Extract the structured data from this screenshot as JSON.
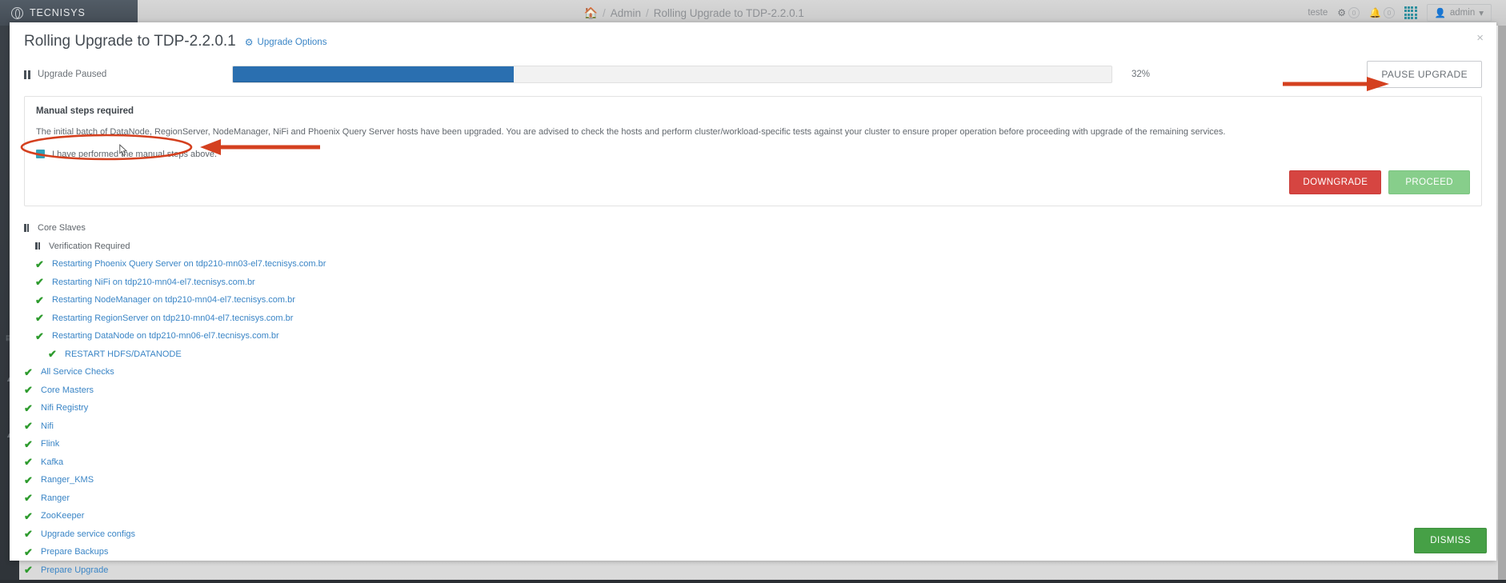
{
  "brand": {
    "name": "TECNISYS",
    "logo_icon": "circle-logo-icon"
  },
  "breadcrumb": {
    "home_icon": "home-icon",
    "sep": "/",
    "items": [
      "Admin",
      "Rolling Upgrade to TDP-2.2.0.1"
    ]
  },
  "topbar_right": {
    "cluster_name": "teste",
    "gear_icon": "gear-icon",
    "gear_badge": "0",
    "bell_icon": "bell-icon",
    "bell_badge": "0",
    "grid_icon": "grid-icon",
    "user_icon": "user-icon",
    "user_label": "admin",
    "caret_icon": "caret-down-icon"
  },
  "modal": {
    "title": "Rolling Upgrade to TDP-2.2.0.1",
    "upgrade_options_label": "Upgrade Options",
    "upgrade_options_icon": "cogs-icon",
    "close_icon": "close-icon",
    "close_glyph": "×"
  },
  "progress": {
    "status_icon": "pause-icon",
    "status_label": "Upgrade Paused",
    "percent_label": "32%",
    "percent_value": 32,
    "bar_color": "#2a6fb0",
    "pause_button_label": "PAUSE UPGRADE"
  },
  "manual_panel": {
    "title": "Manual steps required",
    "description": "The initial batch of DataNode, RegionServer, NodeManager, NiFi and Phoenix Query Server hosts have been upgraded. You are advised to check the hosts and perform cluster/workload-specific tests against your cluster to ensure proper operation before proceeding with upgrade of the remaining services.",
    "checkbox_label": "I have performed the manual steps above.",
    "checkbox_checked": true,
    "checkbox_color": "#2fa2bd",
    "downgrade_label": "DOWNGRADE",
    "downgrade_color": "#d64541",
    "proceed_label": "PROCEED",
    "proceed_color": "#87ce8b"
  },
  "tasks": [
    {
      "label": "Core Slaves",
      "status": "paused",
      "icon": "pause-icon",
      "level": 0
    },
    {
      "label": "Verification Required",
      "status": "paused",
      "icon": "pause-icon",
      "level": 1
    },
    {
      "label": "Restarting Phoenix Query Server on tdp210-mn03-el7.tecnisys.com.br",
      "status": "done",
      "icon": "check-icon",
      "level": 1
    },
    {
      "label": "Restarting NiFi on tdp210-mn04-el7.tecnisys.com.br",
      "status": "done",
      "icon": "check-icon",
      "level": 1
    },
    {
      "label": "Restarting NodeManager on tdp210-mn04-el7.tecnisys.com.br",
      "status": "done",
      "icon": "check-icon",
      "level": 1
    },
    {
      "label": "Restarting RegionServer on tdp210-mn04-el7.tecnisys.com.br",
      "status": "done",
      "icon": "check-icon",
      "level": 1
    },
    {
      "label": "Restarting DataNode on tdp210-mn06-el7.tecnisys.com.br",
      "status": "done",
      "icon": "check-icon",
      "level": 1
    },
    {
      "label": "RESTART HDFS/DATANODE",
      "status": "done",
      "icon": "check-icon",
      "level": 2
    },
    {
      "label": "All Service Checks",
      "status": "done",
      "icon": "check-icon",
      "level": 0
    },
    {
      "label": "Core Masters",
      "status": "done",
      "icon": "check-icon",
      "level": 0
    },
    {
      "label": "Nifi Registry",
      "status": "done",
      "icon": "check-icon",
      "level": 0
    },
    {
      "label": "Nifi",
      "status": "done",
      "icon": "check-icon",
      "level": 0
    },
    {
      "label": "Flink",
      "status": "done",
      "icon": "check-icon",
      "level": 0
    },
    {
      "label": "Kafka",
      "status": "done",
      "icon": "check-icon",
      "level": 0
    },
    {
      "label": "Ranger_KMS",
      "status": "done",
      "icon": "check-icon",
      "level": 0
    },
    {
      "label": "Ranger",
      "status": "done",
      "icon": "check-icon",
      "level": 0
    },
    {
      "label": "ZooKeeper",
      "status": "done",
      "icon": "check-icon",
      "level": 0
    },
    {
      "label": "Upgrade service configs",
      "status": "done",
      "icon": "check-icon",
      "level": 0
    },
    {
      "label": "Prepare Backups",
      "status": "done",
      "icon": "check-icon",
      "level": 0
    },
    {
      "label": "Prepare Upgrade",
      "status": "done",
      "icon": "check-icon",
      "level": 0
    }
  ],
  "footer": {
    "dismiss_label": "DISMISS",
    "dismiss_color": "#46a046"
  },
  "annotations": {
    "color": "#d4401f"
  },
  "check_glyph": "✔"
}
